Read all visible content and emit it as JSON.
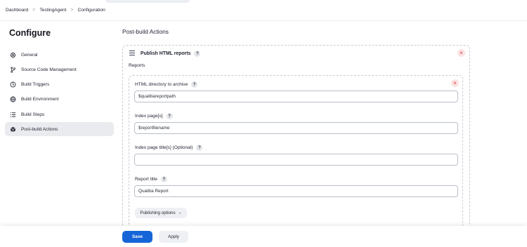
{
  "breadcrumb": {
    "items": [
      "Dashboard",
      "TestingAgent",
      "Configuration"
    ],
    "separator": ">"
  },
  "sidebar": {
    "title": "Configure",
    "items": [
      {
        "label": "General",
        "icon": "gear-icon"
      },
      {
        "label": "Source Code Management",
        "icon": "branch-icon"
      },
      {
        "label": "Build Triggers",
        "icon": "clock-icon"
      },
      {
        "label": "Build Environment",
        "icon": "globe-icon"
      },
      {
        "label": "Build Steps",
        "icon": "list-icon"
      },
      {
        "label": "Post-build Actions",
        "icon": "cube-icon",
        "active": true
      }
    ]
  },
  "main": {
    "section_title": "Post-build Actions",
    "publisher": {
      "title": "Publish HTML reports",
      "reports_label": "Reports",
      "fields": {
        "html_directory": {
          "label": "HTML directory to archive",
          "value": "$qualitiareportpath"
        },
        "index_pages": {
          "label": "Index page[s]",
          "value": "$reportfilename"
        },
        "index_titles": {
          "label": "Index page title[s] (Optional)",
          "value": ""
        },
        "report_title": {
          "label": "Report title",
          "value": "Qualitia Report"
        }
      },
      "publishing_options_label": "Publishing options"
    }
  },
  "footer": {
    "save_label": "Save",
    "apply_label": "Apply"
  },
  "help_glyph": "?",
  "close_glyph": "×",
  "colors": {
    "primary": "#1565d8",
    "active_nav": "#eaebee",
    "close": "#d93a3a"
  }
}
